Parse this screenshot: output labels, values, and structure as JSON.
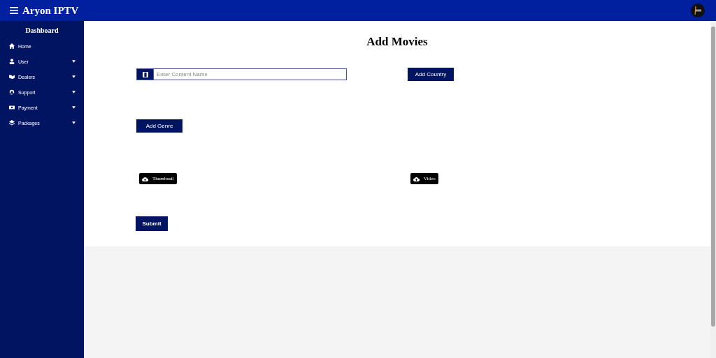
{
  "header": {
    "title": "Aryon IPTV"
  },
  "sidebar": {
    "heading": "Dashboard",
    "items": [
      {
        "label": "Home",
        "has_submenu": false
      },
      {
        "label": "User",
        "has_submenu": true
      },
      {
        "label": "Dealers",
        "has_submenu": true
      },
      {
        "label": "Support",
        "has_submenu": true
      },
      {
        "label": "Payment",
        "has_submenu": true
      },
      {
        "label": "Packages",
        "has_submenu": true
      }
    ]
  },
  "page": {
    "title": "Add Movies",
    "content_name": {
      "placeholder": "Enter Content Name"
    },
    "add_country": "Add Country",
    "add_genre": "Add Genre",
    "uploads": [
      "Thumbnail",
      "Video"
    ],
    "submit": "Submit"
  }
}
